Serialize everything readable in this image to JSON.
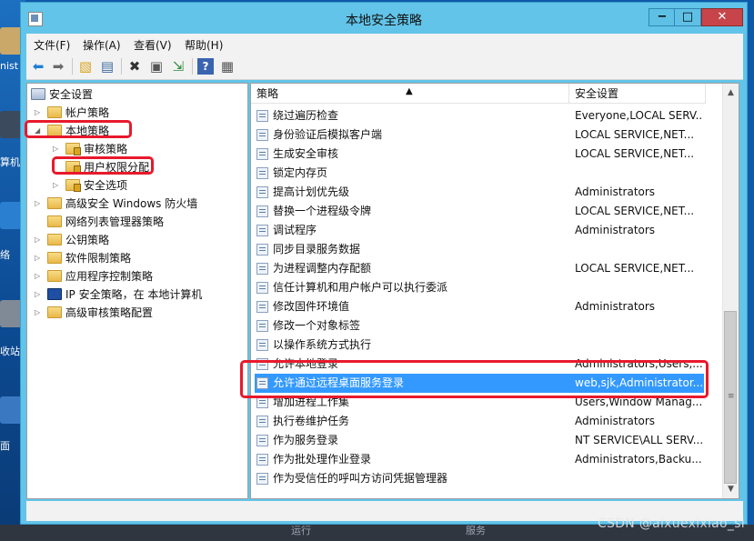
{
  "desktop": {
    "labels": [
      "nist",
      "计算机",
      "网络",
      "回收站",
      "桌面"
    ],
    "label_snippets": [
      "nist",
      "算机",
      "络",
      "收站",
      "面"
    ],
    "watermark": "CSDN @aixuexixiao_si"
  },
  "window": {
    "title": "本地安全策略",
    "buttons": {
      "minimize": "−",
      "maximize": "□",
      "close": "✕"
    }
  },
  "menu": [
    {
      "label": "文件(F)"
    },
    {
      "label": "操作(A)"
    },
    {
      "label": "查看(V)"
    },
    {
      "label": "帮助(H)"
    }
  ],
  "toolbar": {
    "icons": [
      "back-icon",
      "forward-icon",
      "up-folder-icon",
      "show-tree-icon",
      "delete-icon",
      "properties-icon",
      "export-icon",
      "help-icon",
      "view-icon"
    ]
  },
  "tree": {
    "root": "安全设置",
    "items": [
      {
        "label": "帐户策略"
      },
      {
        "label": "本地策略"
      },
      {
        "label": "审核策略"
      },
      {
        "label": "用户权限分配"
      },
      {
        "label": "安全选项"
      },
      {
        "label": "高级安全 Windows 防火墙"
      },
      {
        "label": "网络列表管理器策略"
      },
      {
        "label": "公钥策略"
      },
      {
        "label": "软件限制策略"
      },
      {
        "label": "应用程序控制策略"
      },
      {
        "label": "IP 安全策略，在 本地计算机"
      },
      {
        "label": "高级审核策略配置"
      }
    ]
  },
  "list": {
    "columns": [
      "策略",
      "安全设置"
    ],
    "rows": [
      {
        "policy": "绕过遍历检查",
        "setting": "Everyone,LOCAL SERV..."
      },
      {
        "policy": "身份验证后模拟客户端",
        "setting": "LOCAL SERVICE,NET..."
      },
      {
        "policy": "生成安全审核",
        "setting": "LOCAL SERVICE,NET..."
      },
      {
        "policy": "锁定内存页",
        "setting": ""
      },
      {
        "policy": "提高计划优先级",
        "setting": "Administrators"
      },
      {
        "policy": "替换一个进程级令牌",
        "setting": "LOCAL SERVICE,NET..."
      },
      {
        "policy": "调试程序",
        "setting": "Administrators"
      },
      {
        "policy": "同步目录服务数据",
        "setting": ""
      },
      {
        "policy": "为进程调整内存配额",
        "setting": "LOCAL SERVICE,NET..."
      },
      {
        "policy": "信任计算机和用户帐户可以执行委派",
        "setting": ""
      },
      {
        "policy": "修改固件环境值",
        "setting": "Administrators"
      },
      {
        "policy": "修改一个对象标签",
        "setting": ""
      },
      {
        "policy": "以操作系统方式执行",
        "setting": ""
      },
      {
        "policy": "允许本地登录",
        "setting": "Administrators,Users,..."
      },
      {
        "policy": "允许通过远程桌面服务登录",
        "setting": "web,sjk,Administrator..."
      },
      {
        "policy": "增加进程工作集",
        "setting": "Users,Window Manag..."
      },
      {
        "policy": "执行卷维护任务",
        "setting": "Administrators"
      },
      {
        "policy": "作为服务登录",
        "setting": "NT SERVICE\\ALL SERV..."
      },
      {
        "policy": "作为批处理作业登录",
        "setting": "Administrators,Backu..."
      },
      {
        "policy": "作为受信任的呼叫方访问凭据管理器",
        "setting": ""
      }
    ],
    "selected_index": 14
  },
  "behind_window_text": [
    "运行",
    "服务"
  ]
}
